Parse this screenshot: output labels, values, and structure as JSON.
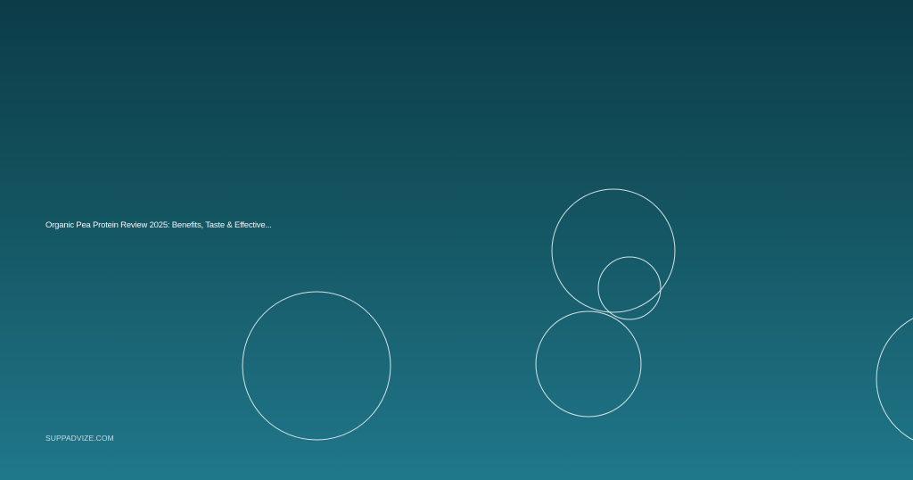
{
  "card": {
    "title": "Organic Pea Protein Review 2025: Benefits, Taste & Effective...",
    "site": "SUPPADVIZE.COM"
  },
  "decorations": {
    "shape": "outline-circle",
    "count": 6
  }
}
